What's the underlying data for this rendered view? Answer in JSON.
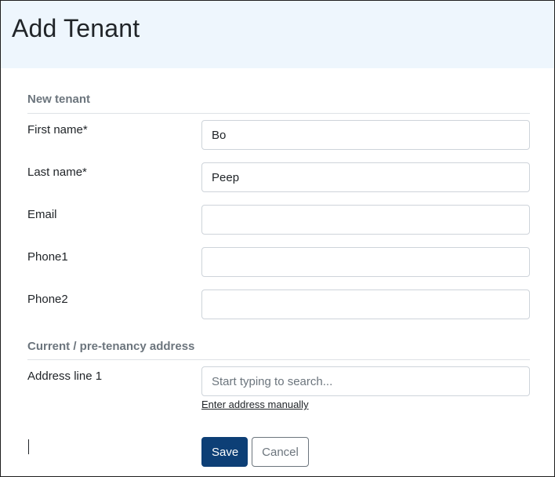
{
  "page": {
    "title": "Add Tenant"
  },
  "sections": {
    "new_tenant": "New tenant",
    "address": "Current / pre-tenancy address"
  },
  "fields": {
    "first_name": {
      "label": "First name*",
      "value": "Bo"
    },
    "last_name": {
      "label": "Last name*",
      "value": "Peep"
    },
    "email": {
      "label": "Email",
      "value": ""
    },
    "phone1": {
      "label": "Phone1",
      "value": ""
    },
    "phone2": {
      "label": "Phone2",
      "value": ""
    },
    "address_line1": {
      "label": "Address line 1",
      "value": "",
      "placeholder": "Start typing to search..."
    }
  },
  "links": {
    "enter_manually": "Enter address manually"
  },
  "buttons": {
    "save": "Save",
    "cancel": "Cancel"
  },
  "colors": {
    "header_bg": "#eef6fd",
    "primary": "#0d3f76",
    "muted": "#6c757d"
  }
}
